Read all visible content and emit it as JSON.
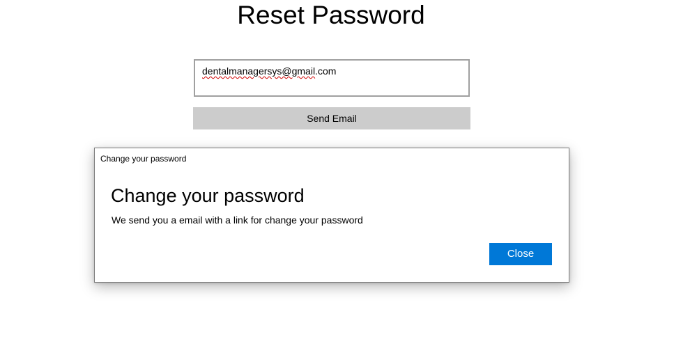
{
  "page": {
    "title": "Reset Password"
  },
  "email": {
    "value_misspelled_part": "dentalmanagersys@gmail",
    "value_rest": ".com"
  },
  "send_button": {
    "label": "Send Email"
  },
  "dialog": {
    "window_title": "Change your password",
    "heading": "Change your password",
    "message": "We send you a email with a link for change your password",
    "close_label": "Close",
    "accent_color": "#0078d7"
  }
}
